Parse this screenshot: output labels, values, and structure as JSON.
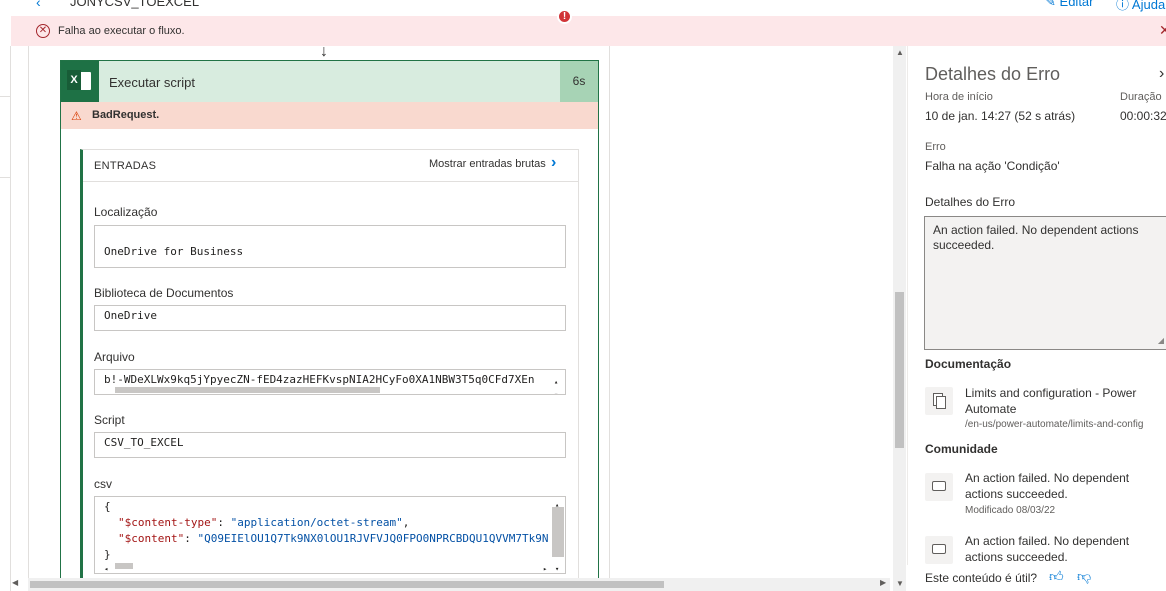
{
  "header": {
    "flow_name": "JONYCSV_TOEXCEL",
    "edit_label": "Editar",
    "help_label": "Ajuda"
  },
  "banner": {
    "message": "Falha ao executar o fluxo."
  },
  "card": {
    "title": "Executar script",
    "duration": "6s",
    "error_badge": "!",
    "error_text": "BadRequest."
  },
  "inputs": {
    "heading": "ENTRADAS",
    "raw_link": "Mostrar entradas brutas",
    "fields": [
      {
        "label": "Localização",
        "value": "OneDrive for Business"
      },
      {
        "label": "Biblioteca de Documentos",
        "value": "OneDrive"
      },
      {
        "label": "Arquivo",
        "value": "b!-WDeXLWx9kq5jYpyecZN-fED4zazHEFKvspNIA2HCyFo0XA1NBW3T5q0CFd7XEn"
      },
      {
        "label": "Script",
        "value": "CSV_TO_EXCEL"
      },
      {
        "label": "csv",
        "value": ""
      }
    ],
    "csv_json": {
      "open_brace": "{",
      "content_type_key": "\"$content-type\"",
      "content_type_value": "\"application/octet-stream\"",
      "content_key": "\"$content\"",
      "content_value": "\"Q09EIElOU1Q7Tk9NX0lOU1RJVFVJQ0FPO0NPRCBDQU1QVVM7Tk9N",
      "close_brace": "}"
    }
  },
  "panel": {
    "title": "Detalhes do Erro",
    "start_label": "Hora de início",
    "start_value": "10 de jan. 14:27 (52 s atrás)",
    "duration_label": "Duração",
    "duration_value": "00:00:32",
    "error_label": "Erro",
    "error_value": "Falha na ação 'Condição'",
    "details_heading": "Detalhes do Erro",
    "details_text": "An action failed. No dependent actions succeeded.",
    "doc_heading": "Documentação",
    "doc_link": {
      "title": "Limits and configuration - Power Automate",
      "url": "/en-us/power-automate/limits-and-config"
    },
    "community_heading": "Comunidade",
    "community_links": [
      {
        "title": "An action failed. No dependent actions succeeded.",
        "meta": "Modificado 08/03/22"
      },
      {
        "title": "An action failed. No dependent actions succeeded.",
        "meta": ""
      }
    ],
    "feedback": "Este conteúdo é útil?"
  },
  "icons": {
    "back": "back-arrow-icon",
    "edit": "pencil-icon",
    "help": "help-circle-icon",
    "banner": "error-circle-icon",
    "excel": "excel-icon",
    "warning": "warning-icon",
    "chevron": "chevron-right-icon",
    "doc": "document-icon",
    "community": "comment-icon",
    "like": "thumb-up-icon",
    "dislike": "thumb-down-icon"
  },
  "colors": {
    "accent": "#0078d4",
    "excel_green": "#217346",
    "error_red": "#a4262c",
    "banner_bg": "#fde7e9",
    "bad_request_bg": "#f9d9cf"
  }
}
